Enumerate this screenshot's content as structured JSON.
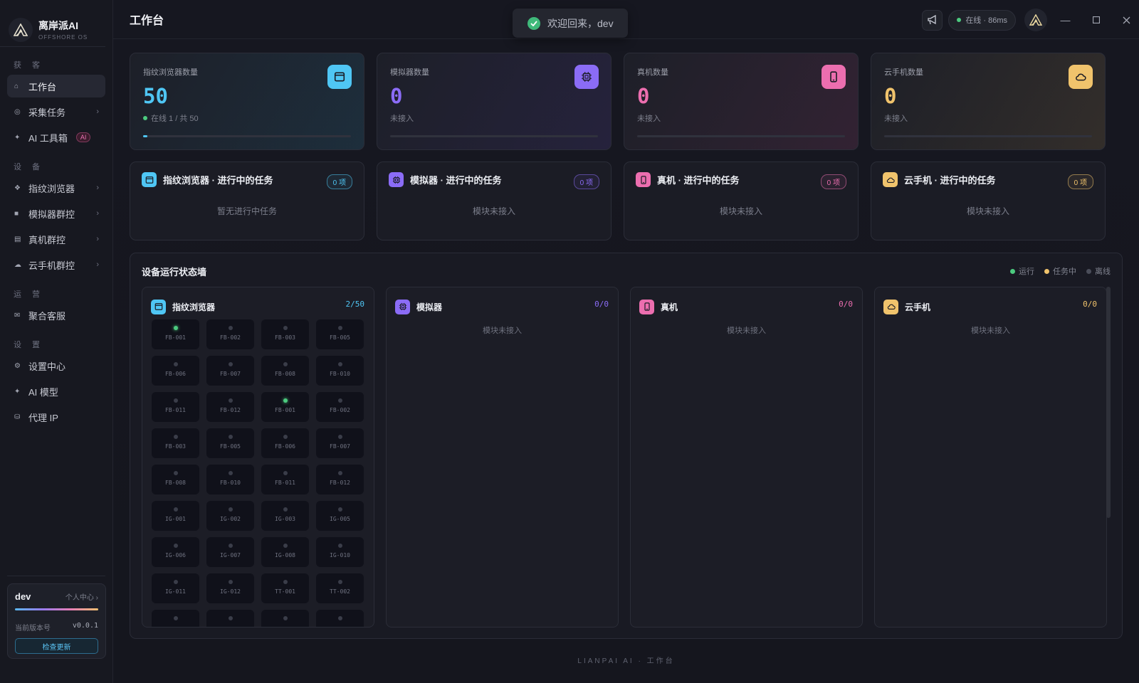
{
  "brand": {
    "name": "离岸派AI",
    "sub": "OFFSHORE OS"
  },
  "sidebar": {
    "sections": [
      {
        "title": "获 客",
        "items": [
          {
            "label": "工作台",
            "icon": "home-icon",
            "active": true
          },
          {
            "label": "采集任务",
            "icon": "target-icon",
            "chevron": true
          },
          {
            "label": "AI 工具箱",
            "icon": "sparkle-icon",
            "badge": "AI"
          }
        ]
      },
      {
        "title": "设 备",
        "items": [
          {
            "label": "指纹浏览器",
            "icon": "diamond-icon",
            "chevron": true
          },
          {
            "label": "模拟器群控",
            "icon": "square-icon",
            "chevron": true
          },
          {
            "label": "真机群控",
            "icon": "tablet-icon",
            "chevron": true
          },
          {
            "label": "云手机群控",
            "icon": "cloud-icon",
            "chevron": true
          }
        ]
      },
      {
        "title": "运 营",
        "items": [
          {
            "label": "聚合客服",
            "icon": "mail-icon"
          }
        ]
      },
      {
        "title": "设 置",
        "items": [
          {
            "label": "设置中心",
            "icon": "gear-icon"
          },
          {
            "label": "AI 模型",
            "icon": "sparkle-icon"
          },
          {
            "label": "代理 IP",
            "icon": "database-icon"
          }
        ]
      }
    ]
  },
  "user": {
    "name": "dev",
    "center": "个人中心 ›",
    "version_label": "当前版本号",
    "version": "v0.0.1",
    "update_button": "检查更新"
  },
  "topbar": {
    "title": "工作台",
    "toast": "欢迎回来，dev",
    "status": "在线 · 86ms",
    "status_color": "#4ccb7f"
  },
  "stats": [
    {
      "label": "指纹浏览器数量",
      "value": "50",
      "sub": "在线 1 / 共 50",
      "color": "#4fc6f4",
      "icon": "browser-icon",
      "progress": 0.02,
      "online_dot": true
    },
    {
      "label": "模拟器数量",
      "value": "0",
      "sub": "未接入",
      "color": "#8b6cf6",
      "icon": "chip-icon",
      "progress": 0
    },
    {
      "label": "真机数量",
      "value": "0",
      "sub": "未接入",
      "color": "#ec6eaf",
      "icon": "phone-icon",
      "progress": 0
    },
    {
      "label": "云手机数量",
      "value": "0",
      "sub": "未接入",
      "color": "#f0c36c",
      "icon": "cloud-icon",
      "progress": 0
    }
  ],
  "tasks": [
    {
      "title": "指纹浏览器 · 进行中的任务",
      "count": "0 项",
      "empty": "暂无进行中任务",
      "color": "#4fc6f4",
      "icon": "browser-icon"
    },
    {
      "title": "模拟器 · 进行中的任务",
      "count": "0 项",
      "empty": "模块未接入",
      "color": "#8b6cf6",
      "icon": "chip-icon"
    },
    {
      "title": "真机 · 进行中的任务",
      "count": "0 项",
      "empty": "模块未接入",
      "color": "#ec6eaf",
      "icon": "phone-icon"
    },
    {
      "title": "云手机 · 进行中的任务",
      "count": "0 项",
      "empty": "模块未接入",
      "color": "#f0c36c",
      "icon": "cloud-icon"
    }
  ],
  "wall": {
    "title": "设备运行状态墙",
    "legend": [
      {
        "label": "运行",
        "color": "#4ccb7f"
      },
      {
        "label": "任务中",
        "color": "#f0c36c"
      },
      {
        "label": "离线",
        "color": "#4a4d59"
      }
    ],
    "columns": [
      {
        "name": "指纹浏览器",
        "count": "2/50",
        "color": "#4fc6f4",
        "icon": "browser-icon",
        "devices": [
          {
            "id": "FB-001",
            "online": true
          },
          {
            "id": "FB-002"
          },
          {
            "id": "FB-003"
          },
          {
            "id": "FB-005"
          },
          {
            "id": "FB-006"
          },
          {
            "id": "FB-007"
          },
          {
            "id": "FB-008"
          },
          {
            "id": "FB-010"
          },
          {
            "id": "FB-011"
          },
          {
            "id": "FB-012"
          },
          {
            "id": "FB-001",
            "online": true
          },
          {
            "id": "FB-002"
          },
          {
            "id": "FB-003"
          },
          {
            "id": "FB-005"
          },
          {
            "id": "FB-006"
          },
          {
            "id": "FB-007"
          },
          {
            "id": "FB-008"
          },
          {
            "id": "FB-010"
          },
          {
            "id": "FB-011"
          },
          {
            "id": "FB-012"
          },
          {
            "id": "IG-001"
          },
          {
            "id": "IG-002"
          },
          {
            "id": "IG-003"
          },
          {
            "id": "IG-005"
          },
          {
            "id": "IG-006"
          },
          {
            "id": "IG-007"
          },
          {
            "id": "IG-008"
          },
          {
            "id": "IG-010"
          },
          {
            "id": "IG-011"
          },
          {
            "id": "IG-012"
          },
          {
            "id": "TT-001"
          },
          {
            "id": "TT-002"
          },
          {
            "id": ""
          },
          {
            "id": ""
          },
          {
            "id": ""
          },
          {
            "id": ""
          }
        ]
      },
      {
        "name": "模拟器",
        "count": "0/0",
        "color": "#8b6cf6",
        "icon": "chip-icon",
        "empty": "模块未接入"
      },
      {
        "name": "真机",
        "count": "0/0",
        "color": "#ec6eaf",
        "icon": "phone-icon",
        "empty": "模块未接入"
      },
      {
        "name": "云手机",
        "count": "0/0",
        "color": "#f0c36c",
        "icon": "cloud-icon",
        "empty": "模块未接入"
      }
    ]
  },
  "footer": "LIANPAI AI · 工作台"
}
